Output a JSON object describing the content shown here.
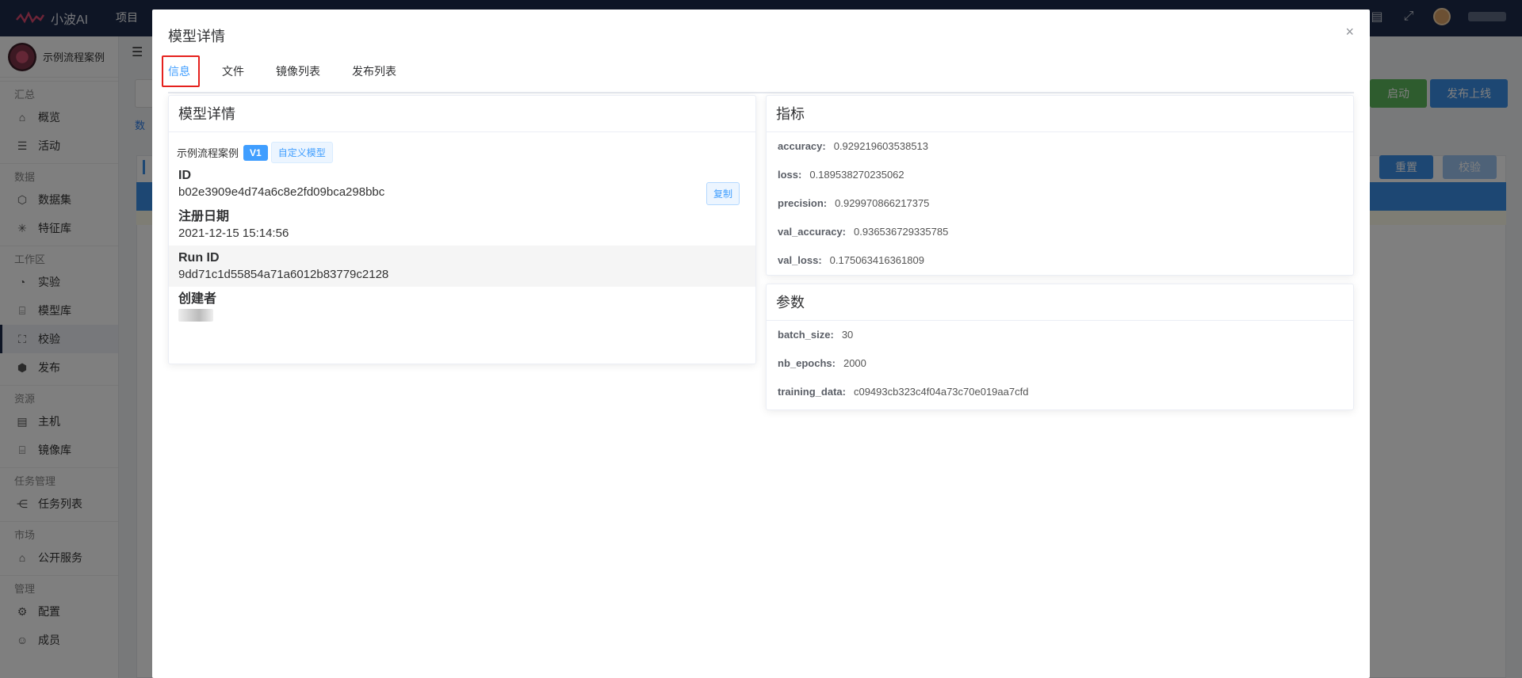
{
  "app": {
    "brand": "小波AI",
    "nav_project": "项目"
  },
  "sidebar": {
    "project_name": "示例流程案例",
    "groups": [
      {
        "label": "汇总",
        "items": [
          {
            "label": "概览",
            "icon": "home-icon"
          },
          {
            "label": "活动",
            "icon": "activity-icon"
          }
        ]
      },
      {
        "label": "数据",
        "items": [
          {
            "label": "数据集",
            "icon": "cube-icon"
          },
          {
            "label": "特征库",
            "icon": "network-icon"
          }
        ]
      },
      {
        "label": "工作区",
        "items": [
          {
            "label": "实验",
            "icon": "dashboard-icon"
          },
          {
            "label": "模型库",
            "icon": "bank-icon"
          },
          {
            "label": "校验",
            "icon": "scan-icon"
          },
          {
            "label": "发布",
            "icon": "box-icon"
          }
        ]
      },
      {
        "label": "资源",
        "items": [
          {
            "label": "主机",
            "icon": "server-icon"
          },
          {
            "label": "镜像库",
            "icon": "bank-icon"
          }
        ]
      },
      {
        "label": "任务管理",
        "items": [
          {
            "label": "任务列表",
            "icon": "share-icon"
          }
        ]
      },
      {
        "label": "市场",
        "items": [
          {
            "label": "公开服务",
            "icon": "shop-icon"
          }
        ]
      },
      {
        "label": "管理",
        "items": [
          {
            "label": "配置",
            "icon": "gear-icon"
          },
          {
            "label": "成员",
            "icon": "user-icon"
          }
        ]
      }
    ]
  },
  "background": {
    "tab_partial": "数",
    "start_button": "启动",
    "publish_button": "发布上线",
    "reset_button": "重置",
    "check_button": "校验"
  },
  "modal": {
    "title": "模型详情",
    "close_icon": "×",
    "tabs": [
      {
        "label": "信息",
        "active": true
      },
      {
        "label": "文件",
        "active": false
      },
      {
        "label": "镜像列表",
        "active": false
      },
      {
        "label": "发布列表",
        "active": false
      }
    ],
    "details_card": {
      "title": "模型详情",
      "model_name": "示例流程案例",
      "version_tag": "V1",
      "type_tag": "自定义模型",
      "id_label": "ID",
      "id_value": "b02e3909e4d74a6c8e2fd09bca298bbc",
      "copy_button": "复制",
      "date_label": "注册日期",
      "date_value": "2021-12-15 15:14:56",
      "run_id_label": "Run ID",
      "run_id_value": "9dd71c1d55854a71a6012b83779c2128",
      "creator_label": "创建者"
    },
    "metrics_card": {
      "title": "指标",
      "items": [
        {
          "key": "accuracy:",
          "value": "0.929219603538513"
        },
        {
          "key": "loss:",
          "value": "0.189538270235062"
        },
        {
          "key": "precision:",
          "value": "0.929970866217375"
        },
        {
          "key": "val_accuracy:",
          "value": "0.936536729335785"
        },
        {
          "key": "val_loss:",
          "value": "0.175063416361809"
        }
      ]
    },
    "params_card": {
      "title": "参数",
      "items": [
        {
          "key": "batch_size:",
          "value": "30"
        },
        {
          "key": "nb_epochs:",
          "value": "2000"
        },
        {
          "key": "training_data:",
          "value": "c09493cb323c4f04a73c70e019aa7cfd"
        }
      ]
    }
  },
  "colors": {
    "topbar": "#1d2b4a",
    "accent": "#409eff",
    "highlight_border": "#e5211d",
    "start_green": "#5cb85c"
  }
}
